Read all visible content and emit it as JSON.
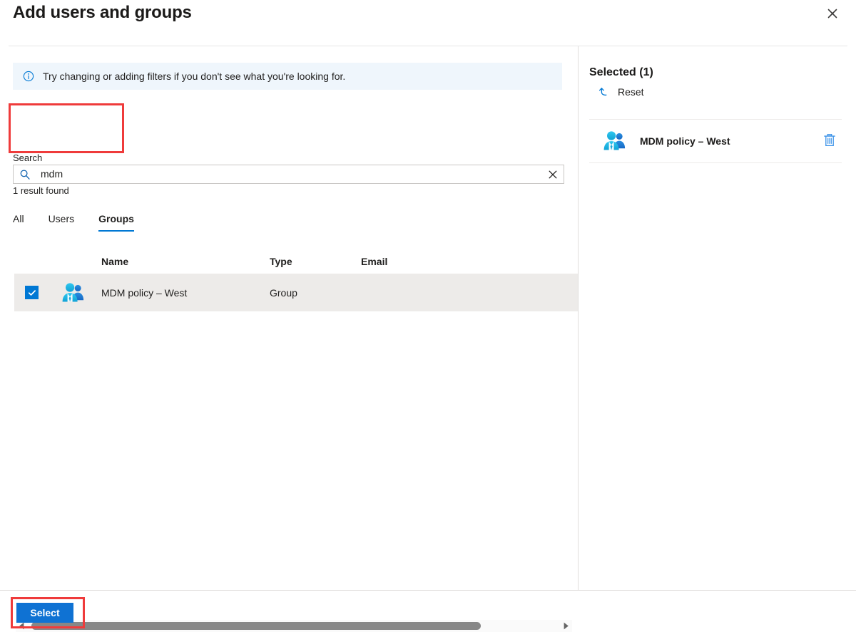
{
  "dialog": {
    "title": "Add users and groups",
    "close_icon": "close-icon"
  },
  "info_bar": {
    "icon": "info-circle-icon",
    "message": "Try changing or adding filters if you don't see what you're looking for."
  },
  "search": {
    "label": "Search",
    "value": "mdm",
    "placeholder": "",
    "search_icon": "search-icon",
    "clear_icon": "clear-icon",
    "result_count": "1 result found"
  },
  "tabs": [
    {
      "label": "All",
      "active": false
    },
    {
      "label": "Users",
      "active": false
    },
    {
      "label": "Groups",
      "active": true
    }
  ],
  "table": {
    "columns": [
      "Name",
      "Type",
      "Email"
    ],
    "rows": [
      {
        "checked": true,
        "avatar_icon": "group-avatar-icon",
        "name": "MDM policy – West",
        "type": "Group",
        "email": ""
      }
    ]
  },
  "scrollbar": {
    "left_arrow_icon": "chevron-left-icon",
    "right_arrow_icon": "chevron-right-icon"
  },
  "footer": {
    "select_label": "Select"
  },
  "selected_panel": {
    "title": "Selected (1)",
    "reset_label": "Reset",
    "reset_icon": "undo-icon",
    "items": [
      {
        "avatar_icon": "group-avatar-icon",
        "name": "MDM policy – West",
        "delete_icon": "trash-icon"
      }
    ]
  },
  "annotations": {
    "search_highlight": "red-callout-box",
    "select_highlight": "red-callout-box"
  },
  "colors": {
    "accent": "#0078d4",
    "primary_button": "#0f72d3",
    "info_bar_bg": "#eff6fc",
    "row_selected_bg": "#edebe9",
    "annotation_red": "#ef3b3b"
  }
}
